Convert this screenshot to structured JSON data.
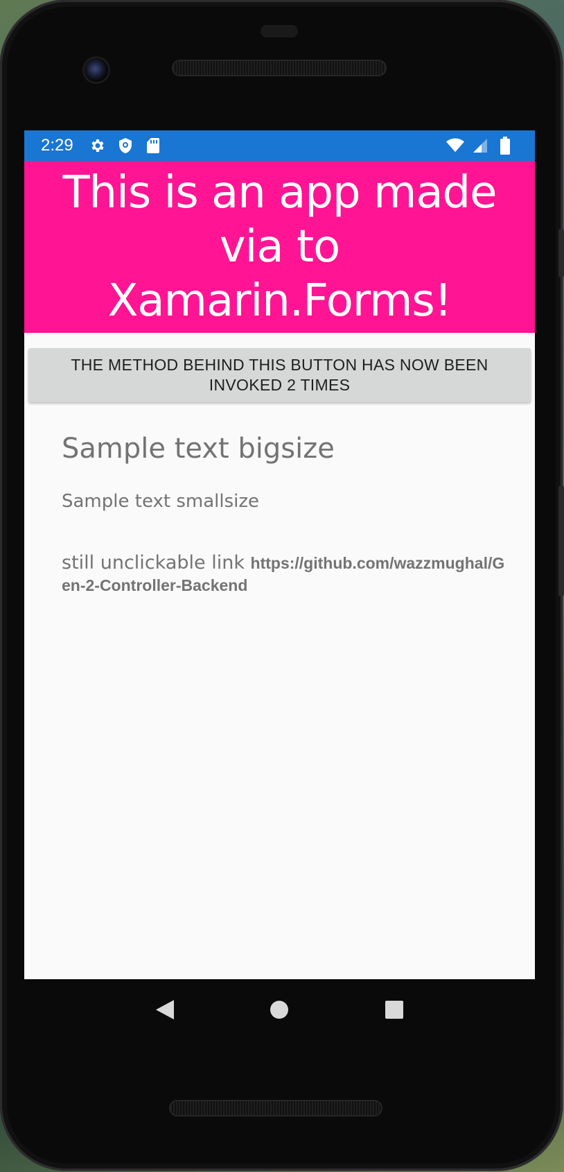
{
  "status_bar": {
    "time": "2:29",
    "left_icons": [
      "gear-icon",
      "shield-icon",
      "sd-card-icon"
    ],
    "right_icons": [
      "wifi-icon",
      "signal-icon",
      "battery-icon"
    ],
    "color": "#1976d2"
  },
  "header": {
    "title": "This is an app made via to Xamarin.Forms!",
    "background": "#ff1493"
  },
  "counter_button": {
    "label": "THE METHOD BEHIND THIS BUTTON HAS NOW BEEN INVOKED 2 TIMES"
  },
  "content": {
    "big_text": "Sample text bigsize",
    "small_text": "Sample text smallsize",
    "link_prefix": "still unclickable link ",
    "link_url": "https://github.com/wazzmughal/Gen-2-Controller-Backend"
  },
  "nav_bar": {
    "buttons": [
      "back-icon",
      "home-icon",
      "recents-icon"
    ]
  }
}
